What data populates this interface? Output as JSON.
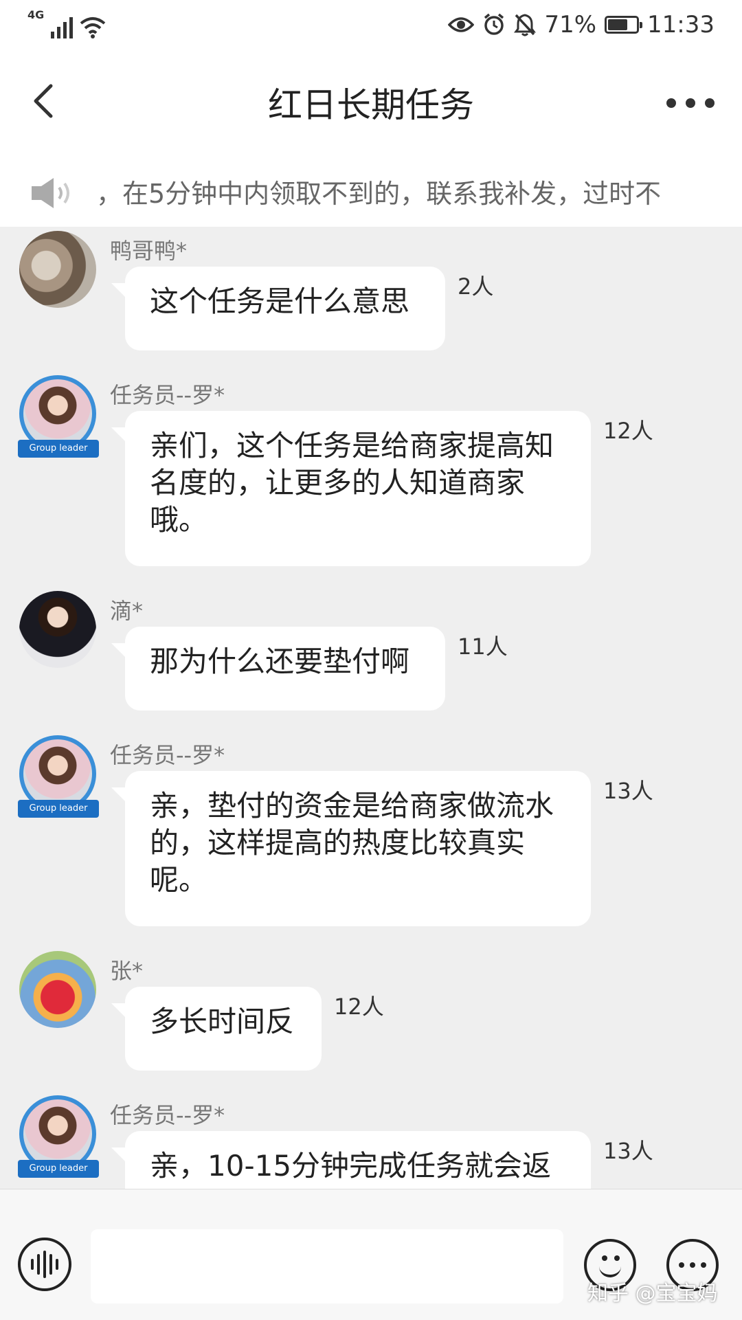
{
  "status_bar": {
    "network": "4G",
    "battery": "71%",
    "battery_level": 0.71,
    "time": "11:33",
    "icons": [
      "signal-icon",
      "wifi-icon",
      "eye-icon",
      "alarm-icon",
      "mute-icon",
      "battery-icon"
    ]
  },
  "header": {
    "title": "红日长期任务",
    "back_icon": "chevron-left-icon",
    "more_icon": "more-dots-icon"
  },
  "notice": {
    "icon": "speaker-icon",
    "text": "，在5分钟中内领取不到的，联系我补发，过时不"
  },
  "messages": [
    {
      "sender": "鸭哥鸭*",
      "text": "这个任务是什么意思",
      "read_count": "2人",
      "group_leader": false
    },
    {
      "sender": "任务员--罗*",
      "text": "亲们，这个任务是给商家提高知名度的，让更多的人知道商家哦。",
      "read_count": "12人",
      "group_leader": true,
      "badge": "Group leader"
    },
    {
      "sender": "滴*",
      "text": "那为什么还要垫付啊",
      "read_count": "11人",
      "group_leader": false
    },
    {
      "sender": "任务员--罗*",
      "text": "亲，垫付的资金是给商家做流水的，这样提高的热度比较真实呢。",
      "read_count": "13人",
      "group_leader": true,
      "badge": "Group leader"
    },
    {
      "sender": "张*",
      "text": "多长时间反",
      "read_count": "12人",
      "group_leader": false
    },
    {
      "sender": "任务员--罗*",
      "text": "亲，10-15分钟完成任务就会返",
      "read_count": "13人",
      "group_leader": true,
      "badge": "Group leader"
    }
  ],
  "input_bar": {
    "voice_icon": "voice-wave-icon",
    "input_value": "",
    "emoji_icon": "emoji-icon",
    "more_icon": "more-options-icon",
    "watermark": "知乎 @宝宝妈"
  }
}
